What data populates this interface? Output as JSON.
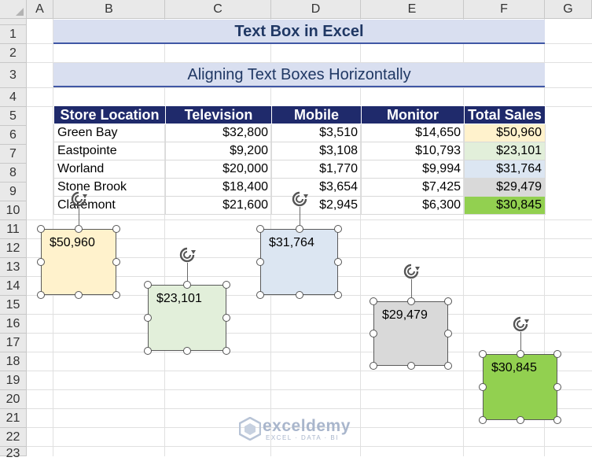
{
  "columns": [
    "A",
    "B",
    "C",
    "D",
    "E",
    "F",
    "G"
  ],
  "rows": [
    "1",
    "2",
    "3",
    "4",
    "5",
    "6",
    "7",
    "8",
    "9",
    "10",
    "11",
    "12",
    "13",
    "14",
    "15",
    "16",
    "17",
    "18",
    "19",
    "20",
    "21",
    "22",
    "23"
  ],
  "title": "Text Box in Excel",
  "subtitle": "Aligning Text Boxes Horizontally",
  "table": {
    "headers": [
      "Store Location",
      "Television",
      "Mobile",
      "Monitor",
      "Total Sales"
    ],
    "rows": [
      {
        "store": "Green Bay",
        "tv": "$32,800",
        "mobile": "$3,510",
        "monitor": "$14,650",
        "total": "$50,960"
      },
      {
        "store": "Eastpointe",
        "tv": "$9,200",
        "mobile": "$3,108",
        "monitor": "$10,793",
        "total": "$23,101"
      },
      {
        "store": "Worland",
        "tv": "$20,000",
        "mobile": "$1,770",
        "monitor": "$9,994",
        "total": "$31,764"
      },
      {
        "store": "Stone Brook",
        "tv": "$18,400",
        "mobile": "$3,654",
        "monitor": "$7,425",
        "total": "$29,479"
      },
      {
        "store": "Claremont",
        "tv": "$21,600",
        "mobile": "$2,945",
        "monitor": "$6,300",
        "total": "$30,845"
      }
    ],
    "total_colors": [
      "#fff2cc",
      "#e2efda",
      "#dce6f2",
      "#d9d9d9",
      "#92d050"
    ]
  },
  "text_boxes": [
    {
      "text": "$50,960",
      "fill": "#fff2cc"
    },
    {
      "text": "$23,101",
      "fill": "#e2efda"
    },
    {
      "text": "$31,764",
      "fill": "#dce6f2"
    },
    {
      "text": "$29,479",
      "fill": "#d9d9d9"
    },
    {
      "text": "$30,845",
      "fill": "#92d050"
    }
  ],
  "icons": {
    "rotate": "rotate-handle-icon",
    "logo": "exceldemy-logo-icon"
  },
  "watermark": {
    "name": "exceldemy",
    "tagline": "EXCEL · DATA · BI"
  },
  "colors": {
    "header_fill": "#1f2a6b",
    "title_fill": "#d9dff0",
    "title_text": "#203864",
    "title_border": "#4057a5"
  }
}
